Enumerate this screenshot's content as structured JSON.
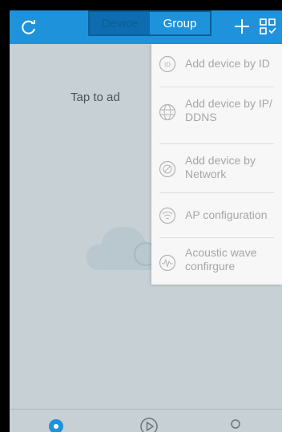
{
  "header": {
    "tabs": [
      {
        "label": "Device",
        "active": true
      },
      {
        "label": "Group",
        "active": false
      }
    ]
  },
  "main": {
    "hint": "Tap to ad"
  },
  "menu": {
    "items": [
      {
        "label": "Add device by ID",
        "icon": "id-icon"
      },
      {
        "label": "Add device by IP/\nDDNS",
        "icon": "globe-icon"
      },
      {
        "label": "Add device by\nNetwork",
        "icon": "network-icon"
      },
      {
        "label": "AP configuration",
        "icon": "wifi-icon"
      },
      {
        "label": "Acoustic wave\nconfirgure",
        "icon": "wave-icon"
      }
    ]
  },
  "colors": {
    "accent": "#1e93dc",
    "menu_text": "#a6a6a6",
    "background": "#c7d0d4"
  }
}
